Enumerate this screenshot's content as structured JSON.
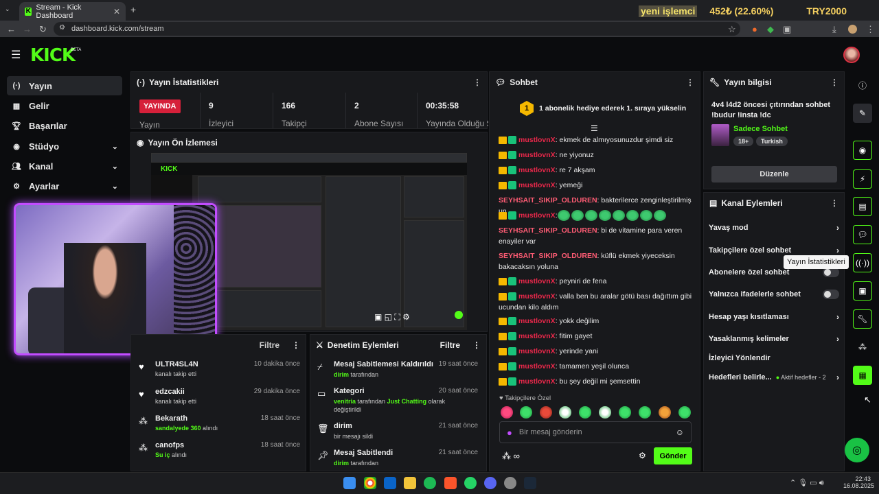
{
  "browser": {
    "tab_title": "Stream - Kick Dashboard",
    "url": "dashboard.kick.com/stream",
    "ticker": {
      "label": "yeni işlemci",
      "value": "452₺ (22.60%)",
      "symbol": "TRY2000"
    }
  },
  "header": {
    "logo": "KICK",
    "beta": "BETA"
  },
  "sidebar": {
    "items": [
      {
        "label": "Yayın",
        "icon": "broadcast-icon"
      },
      {
        "label": "Gelir",
        "icon": "revenue-icon"
      },
      {
        "label": "Başarılar",
        "icon": "trophy-icon"
      },
      {
        "label": "Stüdyo",
        "icon": "studio-icon"
      },
      {
        "label": "Kanal",
        "icon": "users-icon"
      },
      {
        "label": "Ayarlar",
        "icon": "gear-icon"
      }
    ]
  },
  "stats": {
    "title": "Yayın İstatistikleri",
    "status_badge": "YAYINDA",
    "status_label": "Yayın",
    "viewers": {
      "value": "9",
      "label": "İzleyici"
    },
    "followers": {
      "value": "166",
      "label": "Takipçi"
    },
    "subs": {
      "value": "2",
      "label": "Abone Sayısı"
    },
    "uptime": {
      "value": "00:35:58",
      "label": "Yayında Olduğu Süre"
    }
  },
  "preview": {
    "title": "Yayın Ön İzlemesi"
  },
  "activity": {
    "filter": "Filtre",
    "items": [
      {
        "name": "ULTR4SL4N",
        "time": "10 dakika önce",
        "desc": "kanalı takip etti"
      },
      {
        "name": "edzcakii",
        "time": "29 dakika önce",
        "desc": "kanalı takip etti"
      },
      {
        "name": "Bekarath",
        "time": "18 saat önce",
        "desc_green": "sandalyede 360",
        "desc": " alındı"
      },
      {
        "name": "canofps",
        "time": "18 saat önce",
        "desc_green": "Su iç",
        "desc": " alındı"
      }
    ]
  },
  "moderation": {
    "title": "Denetim Eylemleri",
    "filter": "Filtre",
    "items": [
      {
        "name": "Mesaj Sabitlemesi Kaldırıldı",
        "time": "19 saat önce",
        "user": "dirim",
        "desc": " tarafından"
      },
      {
        "name": "Kategori",
        "time": "20 saat önce",
        "user": "venitria",
        "desc": " tarafından ",
        "extra_green": "Just Chatting",
        "extra": " olarak değiştirildi"
      },
      {
        "name": "dirim",
        "time": "21 saat önce",
        "desc": "bir mesajı sildi"
      },
      {
        "name": "Mesaj Sabitlendi",
        "time": "21 saat önce",
        "user": "dirim",
        "desc": " tarafından"
      }
    ]
  },
  "chat": {
    "title": "Sohbet",
    "pinned_rank": "1",
    "pinned": "1 abonelik hediye ederek 1. sıraya yükselin",
    "messages": [
      {
        "user": "mustlovnX",
        "text": ": ekmek de almıyosunuzdur şimdi siz"
      },
      {
        "user": "mustlovnX",
        "text": ": ne yiyonuz"
      },
      {
        "user": "mustlovnX",
        "text": ": re 7 akşam"
      },
      {
        "user": "mustlovnX",
        "text": ": yemeği"
      },
      {
        "user": "SEYHSAIT_SIKIP_OLDUREN",
        "text": ": bakterilerce zenginleştirilmiş un"
      },
      {
        "user": "mustlovnX",
        "text": ":"
      },
      {
        "user": "SEYHSAIT_SIKIP_OLDUREN",
        "text": ": bi de vitamine para veren enayiler var"
      },
      {
        "user": "SEYHSAIT_SIKIP_OLDUREN",
        "text": ": küflü ekmek yiyeceksin bakacaksın yoluna"
      },
      {
        "user": "mustlovnX",
        "text": ": peyniri de fena"
      },
      {
        "user": "mustlovnX",
        "text": ": valla ben bu aralar götü bası dağıttım gibi ucundan kilo aldım"
      },
      {
        "user": "mustlovnX",
        "text": ": yokk değilim"
      },
      {
        "user": "mustlovnX",
        "text": ": fitim gayet"
      },
      {
        "user": "mustlovnX",
        "text": ": yerinde yani"
      },
      {
        "user": "mustlovnX",
        "text": ": tamamen yeşil olunca"
      },
      {
        "user": "mustlovnX",
        "text": ": bu şey değil mi şemsettin"
      }
    ],
    "followers_only": "Takipçilere Özel",
    "input_placeholder": "Bir mesaj gönderin",
    "send": "Gönder"
  },
  "stream_info": {
    "title": "Yayın bilgisi",
    "stream_title": "4v4 l4d2 öncesi çıtırından sohbet !budur !insta !dc",
    "category": "Sadece Sohbet",
    "tags": [
      "18+",
      "Turkish"
    ],
    "edit": "Düzenle"
  },
  "channel_actions": {
    "title": "Kanal Eylemleri",
    "items": [
      {
        "label": "Yavaş mod",
        "kind": "chevron"
      },
      {
        "label": "Takipçilere özel sohbet",
        "kind": "chevron"
      },
      {
        "label": "Abonelere özel sohbet",
        "kind": "toggle"
      },
      {
        "label": "Yalnızca ifadelerle sohbet",
        "kind": "toggle"
      },
      {
        "label": "Hesap yaşı kısıtlaması",
        "kind": "chevron"
      },
      {
        "label": "Yasaklanmış kelimeler",
        "kind": "chevron"
      },
      {
        "label": "İzleyici Yönlendir",
        "kind": "none"
      },
      {
        "label": "Hedefleri belirle...",
        "kind": "chevron",
        "note": "Aktif hedefler - 2"
      }
    ]
  },
  "tooltip": "Yayın İstatistikleri",
  "taskbar": {
    "time": "22:43",
    "date": "16.08.2025"
  },
  "colors": {
    "brand": "#53fc18",
    "live": "#d6203a",
    "panel": "#18191c",
    "cam_border": "#c24cff"
  }
}
